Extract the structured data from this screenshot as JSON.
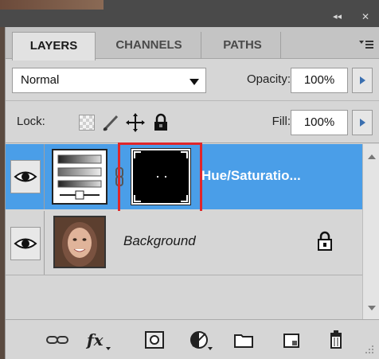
{
  "window": {
    "collapse_glyph": "◂◂",
    "close_glyph": "✕"
  },
  "tabs": [
    {
      "label": "LAYERS",
      "active": true
    },
    {
      "label": "CHANNELS",
      "active": false
    },
    {
      "label": "PATHS",
      "active": false
    }
  ],
  "panel_menu_icon": "panel-menu-icon",
  "blend": {
    "mode": "Normal",
    "opacity_label": "Opacity:",
    "opacity_value": "100%"
  },
  "lock": {
    "label": "Lock:",
    "fill_label": "Fill:",
    "fill_value": "100%"
  },
  "layers": [
    {
      "name": "Hue/Saturatio...",
      "selected": true,
      "visible": true,
      "type": "adjustment",
      "mask_highlighted": true
    },
    {
      "name": "Background",
      "selected": false,
      "visible": true,
      "type": "image",
      "locked": true
    }
  ],
  "toolbar_icons": [
    "link-icon",
    "fx-icon",
    "add-mask-icon",
    "adjustment-icon",
    "folder-icon",
    "new-layer-icon",
    "trash-icon"
  ],
  "colors": {
    "selection": "#4a9ee8",
    "highlight": "#e0262a",
    "panel": "#d6d6d6"
  }
}
